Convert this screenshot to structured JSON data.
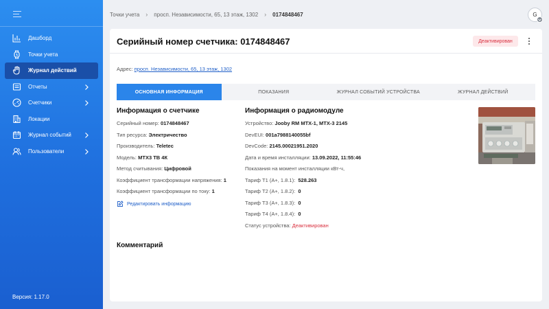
{
  "sidebar": {
    "items": [
      {
        "label": "Дашборд",
        "icon": "chart-icon"
      },
      {
        "label": "Точки учета",
        "icon": "watch-icon"
      },
      {
        "label": "Журнал действий",
        "icon": "hand-icon"
      },
      {
        "label": "Отчеты",
        "icon": "report-icon"
      },
      {
        "label": "Счетчики",
        "icon": "gauge-icon"
      },
      {
        "label": "Локации",
        "icon": "building-icon"
      },
      {
        "label": "Журнал событий",
        "icon": "calendar-icon"
      },
      {
        "label": "Пользователи",
        "icon": "users-icon"
      }
    ],
    "version": "Версия: 1.17.0"
  },
  "breadcrumb": {
    "items": [
      "Точки учета",
      "просп. Независимости, 65, 13 этаж, 1302",
      "0174848467"
    ]
  },
  "user": {
    "initial": "G"
  },
  "header": {
    "title": "Серийный номер счетчика: 0174848467",
    "status": "Деактивирован"
  },
  "address": {
    "label": "Адрес:",
    "value": "просп. Независимости, 65, 13 этаж, 1302"
  },
  "tabs": [
    {
      "label": "ОСНОВНАЯ ИНФОРМАЦИЯ",
      "active": true
    },
    {
      "label": "ПОКАЗАНИЯ"
    },
    {
      "label": "ЖУРНАЛ СОБЫТИЙ УСТРОЙСТВА"
    },
    {
      "label": "ЖУРНАЛ ДЕЙСТВИЙ"
    }
  ],
  "meter_info": {
    "title": "Информация о счетчике",
    "rows": [
      {
        "label": "Серийный номер:",
        "value": "0174848467"
      },
      {
        "label": "Тип ресурса:",
        "value": "Электричество"
      },
      {
        "label": "Производитель:",
        "value": "Teletec"
      },
      {
        "label": "Модель:",
        "value": "МТХ3 ТВ 4К"
      },
      {
        "label": "Метод считывания:",
        "value": "Цифровой"
      },
      {
        "label": "Коэффициент трансформации напряжения:",
        "value": "1"
      },
      {
        "label": "Коэффициент трансформации по току:",
        "value": "1"
      }
    ],
    "edit_label": "Редактировать информацию"
  },
  "radio_info": {
    "title": "Информация о радиомодуле",
    "rows": [
      {
        "label": "Устройство:",
        "value": "Jooby RM MTX-1, MTX-3 2145"
      },
      {
        "label": "DevEUI:",
        "value": "001a7988140055bf"
      },
      {
        "label": "DevCode:",
        "value": "2145.00021951.2020"
      },
      {
        "label": "Дата и время инсталляции:",
        "value": "13.09.2022, 11:55:46"
      },
      {
        "label": "Показания на момент инсталляции кВт-ч,",
        "value": ""
      },
      {
        "label": "Тариф Т1 (A+, 1.8.1):",
        "value": "528.263"
      },
      {
        "label": "Тариф Т2 (A+, 1.8.2):",
        "value": "0"
      },
      {
        "label": "Тариф Т3 (A+, 1.8.3):",
        "value": "0"
      },
      {
        "label": "Тариф Т4 (A+, 1.8.4):",
        "value": "0"
      },
      {
        "label": "Статус устройства:",
        "value": "Деактивирован"
      }
    ]
  },
  "comment": {
    "title": "Комментарий"
  },
  "colors": {
    "accent": "#2b85ea",
    "sidebar": "#1f6fde",
    "danger": "#d9303f"
  }
}
